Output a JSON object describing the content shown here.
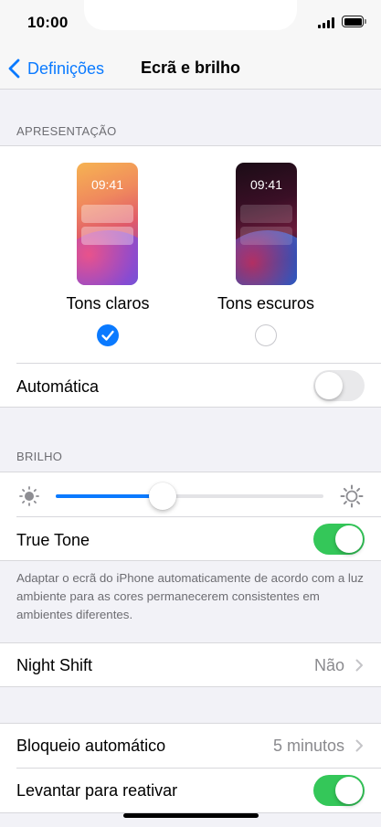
{
  "status_bar": {
    "time": "10:00"
  },
  "nav": {
    "back_label": "Definições",
    "title": "Ecrã e brilho"
  },
  "appearance": {
    "header": "APRESENTAÇÃO",
    "light": {
      "label": "Tons claros",
      "time": "09:41",
      "selected": true
    },
    "dark": {
      "label": "Tons escuros",
      "time": "09:41",
      "selected": false
    },
    "automatic_label": "Automática",
    "automatic_on": false
  },
  "brightness": {
    "header": "BRILHO",
    "level": 0.4,
    "true_tone_label": "True Tone",
    "true_tone_on": true,
    "true_tone_note": "Adaptar o ecrã do iPhone automaticamente de acordo com a luz ambiente para as cores permanecerem consistentes em ambientes diferentes."
  },
  "night_shift": {
    "label": "Night Shift",
    "value": "Não"
  },
  "lock": {
    "auto_lock_label": "Bloqueio automático",
    "auto_lock_value": "5 minutos",
    "raise_to_wake_label": "Levantar para reativar",
    "raise_to_wake_on": true
  },
  "colors": {
    "accent": "#0a7aff",
    "toggle_on": "#34c759"
  }
}
